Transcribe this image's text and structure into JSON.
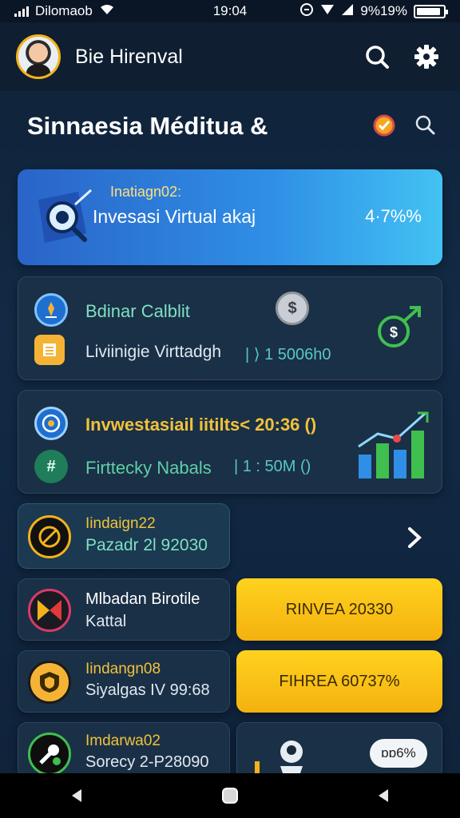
{
  "status_bar": {
    "carrier": "Dilomaob",
    "time": "19:04",
    "battery_text": "9%19%",
    "battery_level": 0.9
  },
  "header": {
    "app_title": "Bie Hirenval",
    "icons": [
      "search-icon",
      "gear-icon"
    ]
  },
  "section": {
    "title": "Sinnaesia Méditua &",
    "icons": [
      "check-badge-icon",
      "search-icon"
    ]
  },
  "hero_card": {
    "small": "Inatiagn02:",
    "main": "Invesasi Virtual akaj",
    "pct": "4·7%%"
  },
  "card2": {
    "line1": "Bdinar Calblit",
    "line2": "Liviinigie Virttadgh",
    "line2_value": "| ⟩ 1 5006h0"
  },
  "card3": {
    "line1": "Invwestasiail iitilts< 20:36 ()",
    "line2": "Firttecky Nabals",
    "line2_value": "| 1 : 50M ()"
  },
  "list": [
    {
      "title": "Iindaign22",
      "subtitle": "Pazadr 2l 92030",
      "action": "chevron"
    },
    {
      "title": "Mlbadan Birotile",
      "subtitle": "Kattal",
      "action_label": "RINVEA 20330"
    },
    {
      "title": "Iindangn08",
      "subtitle": "Siyalgas IV 99:68",
      "action_label": "FIHREA 60737%"
    },
    {
      "title": "Imdarwa02",
      "subtitle": "Sorecy 2-P28090",
      "pill": "ɒɒ6%"
    }
  ],
  "colors": {
    "accent_yellow": "#f4b10e",
    "accent_teal": "#7fe0c4",
    "hero_blue": "#2f8fe6",
    "gold_text": "#f0c23a"
  }
}
